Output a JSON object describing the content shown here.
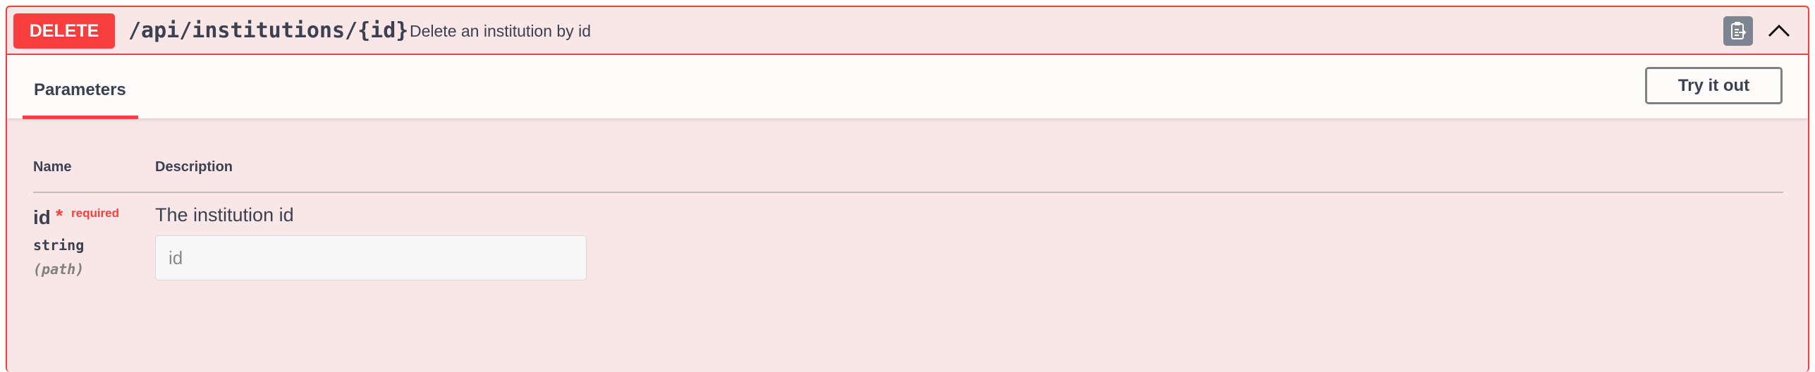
{
  "operation": {
    "method": "DELETE",
    "path": "/api/institutions/{id}",
    "description": "Delete an institution by id",
    "icons": {
      "copy": "clipboard-copy-icon",
      "collapse": "chevron-up-icon"
    }
  },
  "section": {
    "tab_label": "Parameters",
    "try_button": "Try it out"
  },
  "table": {
    "headers": {
      "name": "Name",
      "description": "Description"
    },
    "rows": [
      {
        "name": "id",
        "required_mark": "*",
        "required_label": "required",
        "type": "string",
        "in": "(path)",
        "description": "The institution id",
        "input_placeholder": "id",
        "input_value": ""
      }
    ]
  },
  "colors": {
    "delete_accent": "#f93e3e",
    "block_background": "#f9e6e6",
    "text": "#3b4151"
  }
}
